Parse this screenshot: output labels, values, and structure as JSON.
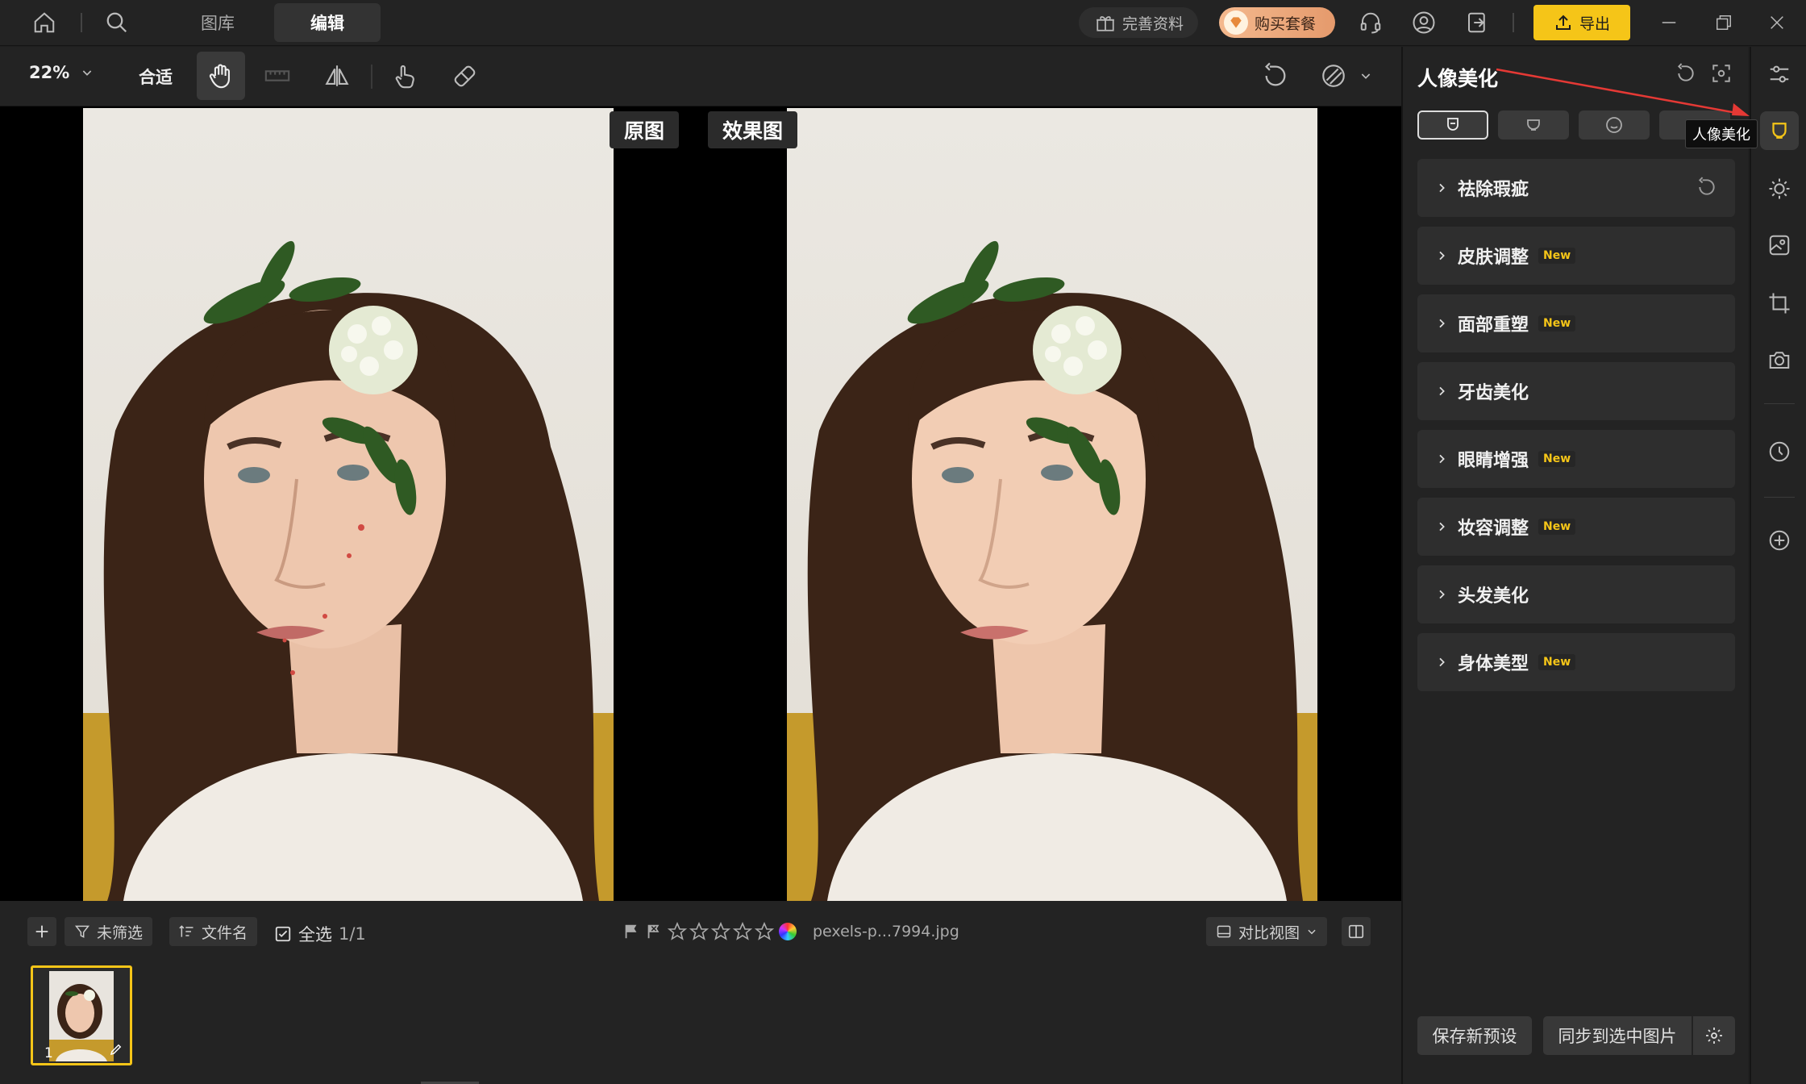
{
  "titlebar": {
    "tabs": [
      "图库",
      "编辑"
    ],
    "active_tab": "编辑",
    "profile_button": "完善资料",
    "buy_button": "购买套餐",
    "export_button": "导出",
    "accent_color": "#f5c518"
  },
  "toolbar": {
    "zoom_value": "22%",
    "fit_label": "合适"
  },
  "canvas": {
    "label_original": "原图",
    "label_result": "效果图"
  },
  "bottom": {
    "filter_label": "未筛选",
    "sort_label": "文件名",
    "select_all_label": "全选",
    "select_count": "1/1",
    "filename": "pexels-p...7994.jpg",
    "view_mode_label": "对比视图",
    "rating_stars": 0
  },
  "filmstrip": {
    "items": [
      {
        "index": "1"
      }
    ]
  },
  "panel": {
    "title": "人像美化",
    "sections": [
      {
        "label": "祛除瑕疵",
        "new": false,
        "reset": true
      },
      {
        "label": "皮肤调整",
        "new": true
      },
      {
        "label": "面部重塑",
        "new": true
      },
      {
        "label": "牙齿美化",
        "new": false
      },
      {
        "label": "眼睛增强",
        "new": true
      },
      {
        "label": "妆容调整",
        "new": true
      },
      {
        "label": "头发美化",
        "new": false
      },
      {
        "label": "身体美型",
        "new": true
      }
    ],
    "new_badge": "New",
    "save_preset_button": "保存新预设",
    "sync_button": "同步到选中图片"
  },
  "sidebar": {
    "tooltip": "人像美化"
  }
}
